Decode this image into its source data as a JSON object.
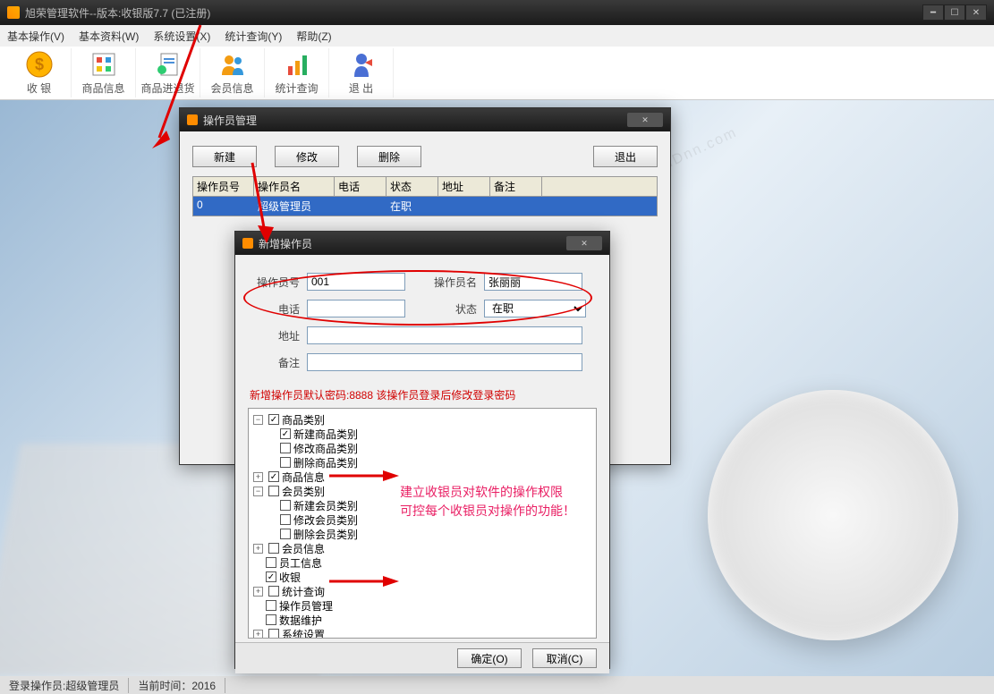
{
  "window": {
    "title": "旭荣管理软件--版本:收银版7.7 (已注册)"
  },
  "menu": {
    "basic_op": "基本操作(V)",
    "basic_data": "基本资料(W)",
    "sys_setting": "系统设置(X)",
    "stat_query": "统计查询(Y)",
    "help": "帮助(Z)"
  },
  "toolbar": {
    "cashier": "收 银",
    "product_info": "商品信息",
    "product_io": "商品进退货",
    "member_info": "会员信息",
    "stat_query": "统计查询",
    "exit": "退 出"
  },
  "statusbar": {
    "operator_label": "登录操作员:超级管理员",
    "time_label": "当前时间：2016"
  },
  "op_dialog": {
    "title": "操作员管理",
    "btn_new": "新建",
    "btn_edit": "修改",
    "btn_delete": "删除",
    "btn_exit": "退出",
    "columns": {
      "id": "操作员号",
      "name": "操作员名",
      "phone": "电话",
      "status": "状态",
      "address": "地址",
      "remark": "备注"
    },
    "row": {
      "id": "0",
      "name": "超级管理员",
      "phone": "",
      "status": "在职",
      "address": "",
      "remark": ""
    }
  },
  "add_dialog": {
    "title": "新增操作员",
    "labels": {
      "id": "操作员号",
      "name": "操作员名",
      "phone": "电话",
      "status": "状态",
      "address": "地址",
      "remark": "备注"
    },
    "values": {
      "id": "001",
      "name": "张丽丽",
      "phone": "",
      "status": "在职",
      "address": "",
      "remark": ""
    },
    "hint": "新增操作员默认密码:8888 该操作员登录后修改登录密码",
    "tree": {
      "product_cat": "商品类别",
      "product_cat_new": "新建商品类别",
      "product_cat_edit": "修改商品类别",
      "product_cat_del": "删除商品类别",
      "product_info": "商品信息",
      "member_cat": "会员类别",
      "member_cat_new": "新建会员类别",
      "member_cat_edit": "修改会员类别",
      "member_cat_del": "删除会员类别",
      "member_info": "会员信息",
      "staff_info": "员工信息",
      "cashier": "收银",
      "stat_query": "统计查询",
      "op_manage": "操作员管理",
      "data_maint": "数据维护",
      "sys_setting": "系统设置"
    },
    "btn_ok": "确定(O)",
    "btn_cancel": "取消(C)"
  },
  "annotation": {
    "line1": "建立收银员对软件的操作权限",
    "line2": "可控每个收银员对操作的功能！"
  },
  "watermark": "www.YuuDnn.com"
}
